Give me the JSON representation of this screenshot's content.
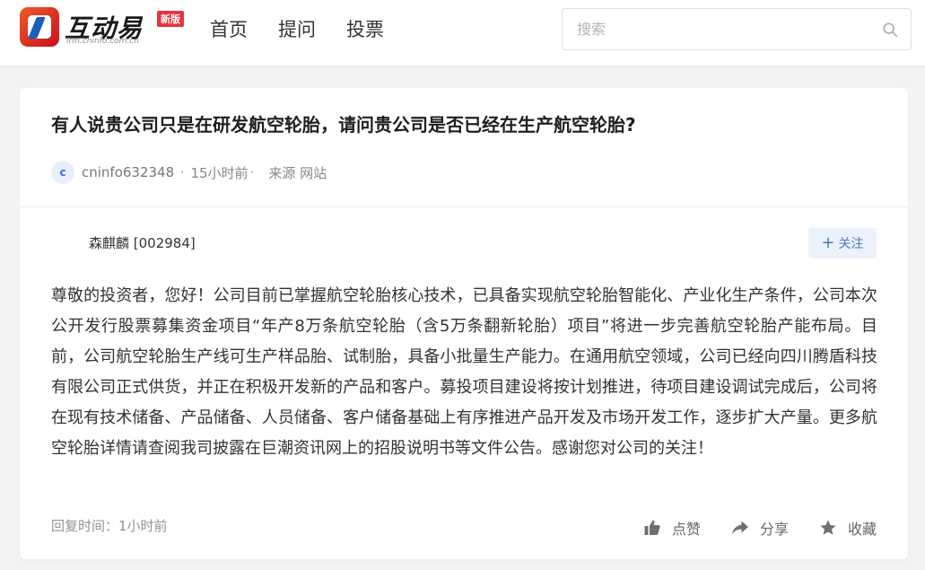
{
  "header": {
    "logo_text": "互动易",
    "logo_subtitle": "irm.cninfo.com.cn",
    "logo_badge": "新版",
    "nav": [
      {
        "label": "首页"
      },
      {
        "label": "提问"
      },
      {
        "label": "投票"
      }
    ],
    "search": {
      "placeholder": "搜索",
      "value": ""
    }
  },
  "question": {
    "title": "有人说贵公司只是在研发航空轮胎，请问贵公司是否已经在生产航空轮胎?",
    "avatar_letter": "c",
    "user": "cninfo632348",
    "time": "15小时前",
    "source": "来源 网站"
  },
  "answer": {
    "company": "森麒麟 [002984]",
    "follow_label": "关注",
    "text": "尊敬的投资者，您好！公司目前已掌握航空轮胎核心技术，已具备实现航空轮胎智能化、产业化生产条件，公司本次公开发行股票募集资金项目“年产8万条航空轮胎（含5万条翻新轮胎）项目”将进一步完善航空轮胎产能布局。目前，公司航空轮胎生产线可生产样品胎、试制胎，具备小批量生产能力。在通用航空领域，公司已经向四川腾盾科技有限公司正式供货，并正在积极开发新的产品和客户。募投项目建设将按计划推进，待项目建设调试完成后，公司将在现有技术储备、产品储备、人员储备、客户储备基础上有序推进产品开发及市场开发工作，逐步扩大产量。更多航空轮胎详情请查阅我司披露在巨潮资讯网上的招股说明书等文件公告。感谢您对公司的关注！",
    "reply_time": "回复时间：1小时前",
    "actions": {
      "like": "点赞",
      "share": "分享",
      "favorite": "收藏"
    }
  },
  "colors": {
    "accent": "#4a78c9",
    "follow_bg": "#ecf2fc",
    "page_bg": "#f2f3f5",
    "icon": "#6b6f76"
  }
}
